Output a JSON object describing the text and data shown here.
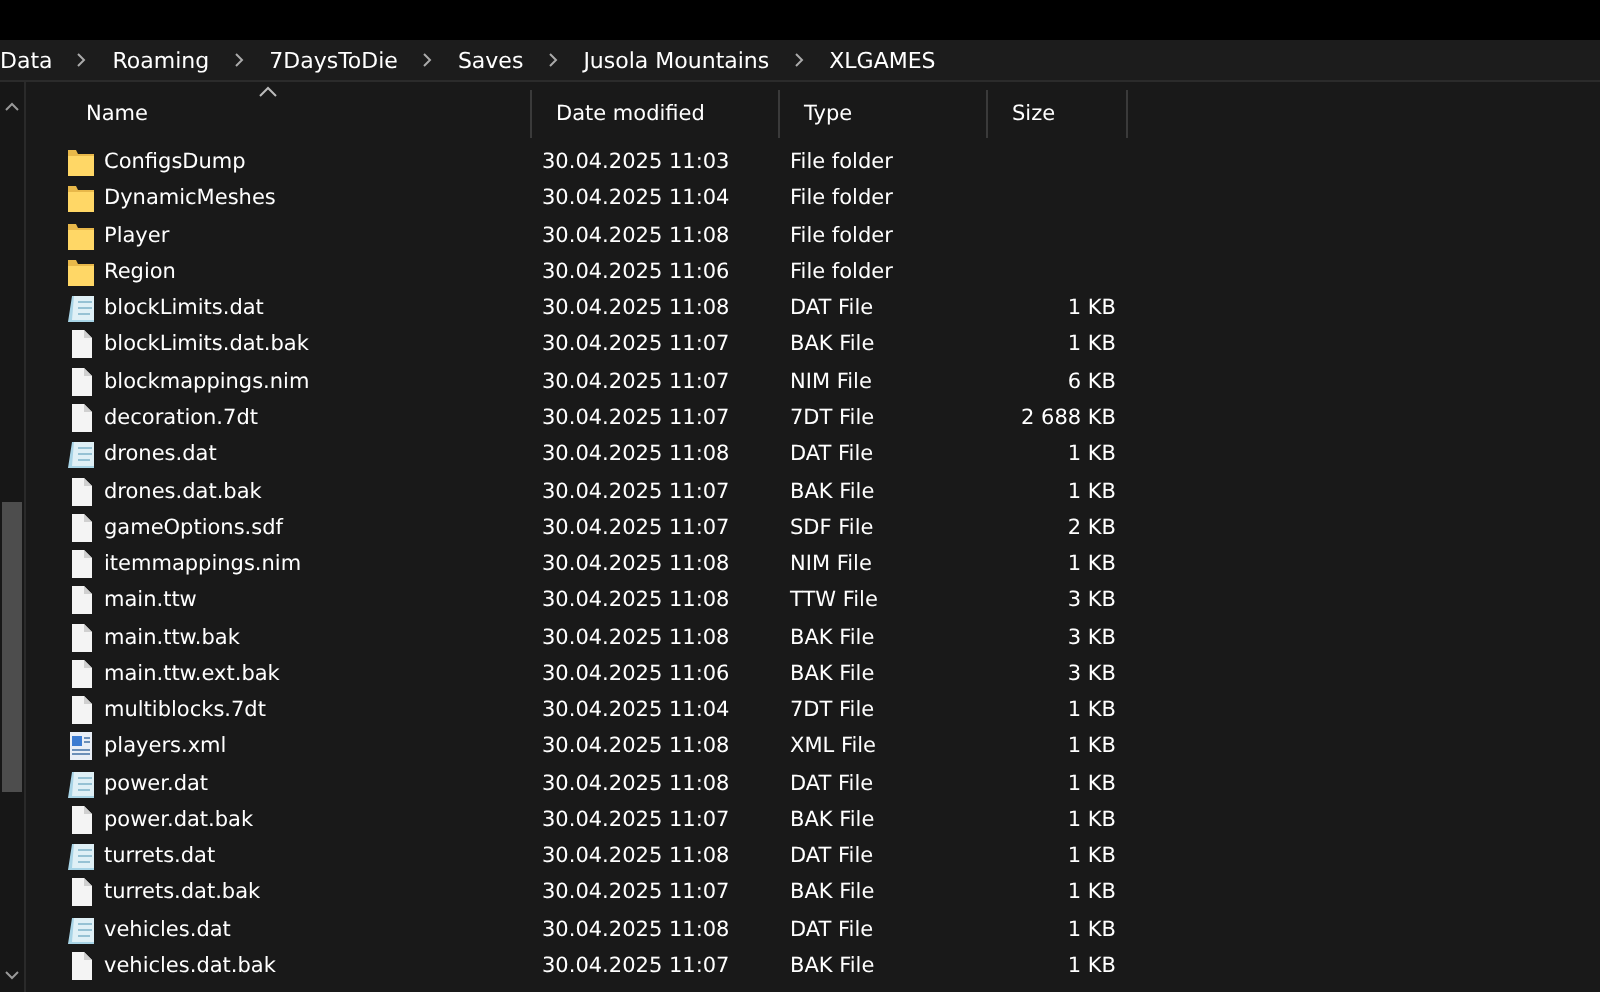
{
  "breadcrumb": [
    "Data",
    "Roaming",
    "7DaysToDie",
    "Saves",
    "Jusola Mountains",
    "XLGAMES"
  ],
  "table": {
    "columns": [
      "Name",
      "Date modified",
      "Type",
      "Size"
    ],
    "rows": [
      {
        "name": "ConfigsDump",
        "date": "30.04.2025 11:03",
        "type": "File folder",
        "kind": "folder"
      },
      {
        "name": "DynamicMeshes",
        "date": "30.04.2025 11:04",
        "type": "File folder",
        "kind": "folder"
      },
      {
        "name": "Player",
        "date": "30.04.2025 11:08",
        "type": "File folder",
        "kind": "folder"
      },
      {
        "name": "Region",
        "date": "30.04.2025 11:06",
        "type": "File folder",
        "kind": "folder"
      },
      {
        "name": "blockLimits.dat",
        "date": "30.04.2025 11:08",
        "type": "DAT File",
        "size": "1 KB",
        "kind": "notepad"
      },
      {
        "name": "blockLimits.dat.bak",
        "date": "30.04.2025 11:07",
        "type": "BAK File",
        "size": "1 KB",
        "kind": "file"
      },
      {
        "name": "blockmappings.nim",
        "date": "30.04.2025 11:07",
        "type": "NIM File",
        "size": "6 KB",
        "kind": "file"
      },
      {
        "name": "decoration.7dt",
        "date": "30.04.2025 11:07",
        "type": "7DT File",
        "size": "2 688 KB",
        "kind": "file"
      },
      {
        "name": "drones.dat",
        "date": "30.04.2025 11:08",
        "type": "DAT File",
        "size": "1 KB",
        "kind": "notepad"
      },
      {
        "name": "drones.dat.bak",
        "date": "30.04.2025 11:07",
        "type": "BAK File",
        "size": "1 KB",
        "kind": "file"
      },
      {
        "name": "gameOptions.sdf",
        "date": "30.04.2025 11:07",
        "type": "SDF File",
        "size": "2 KB",
        "kind": "file"
      },
      {
        "name": "itemmappings.nim",
        "date": "30.04.2025 11:08",
        "type": "NIM File",
        "size": "1 KB",
        "kind": "file"
      },
      {
        "name": "main.ttw",
        "date": "30.04.2025 11:08",
        "type": "TTW File",
        "size": "3 KB",
        "kind": "file"
      },
      {
        "name": "main.ttw.bak",
        "date": "30.04.2025 11:08",
        "type": "BAK File",
        "size": "3 KB",
        "kind": "file"
      },
      {
        "name": "main.ttw.ext.bak",
        "date": "30.04.2025 11:06",
        "type": "BAK File",
        "size": "3 KB",
        "kind": "file"
      },
      {
        "name": "multiblocks.7dt",
        "date": "30.04.2025 11:04",
        "type": "7DT File",
        "size": "1 KB",
        "kind": "file"
      },
      {
        "name": "players.xml",
        "date": "30.04.2025 11:08",
        "type": "XML File",
        "size": "1 KB",
        "kind": "xml"
      },
      {
        "name": "power.dat",
        "date": "30.04.2025 11:08",
        "type": "DAT File",
        "size": "1 KB",
        "kind": "notepad"
      },
      {
        "name": "power.dat.bak",
        "date": "30.04.2025 11:07",
        "type": "BAK File",
        "size": "1 KB",
        "kind": "file"
      },
      {
        "name": "turrets.dat",
        "date": "30.04.2025 11:08",
        "type": "DAT File",
        "size": "1 KB",
        "kind": "notepad"
      },
      {
        "name": "turrets.dat.bak",
        "date": "30.04.2025 11:07",
        "type": "BAK File",
        "size": "1 KB",
        "kind": "file"
      },
      {
        "name": "vehicles.dat",
        "date": "30.04.2025 11:08",
        "type": "DAT File",
        "size": "1 KB",
        "kind": "notepad"
      },
      {
        "name": "vehicles.dat.bak",
        "date": "30.04.2025 11:07",
        "type": "BAK File",
        "size": "1 KB",
        "kind": "file"
      }
    ]
  }
}
